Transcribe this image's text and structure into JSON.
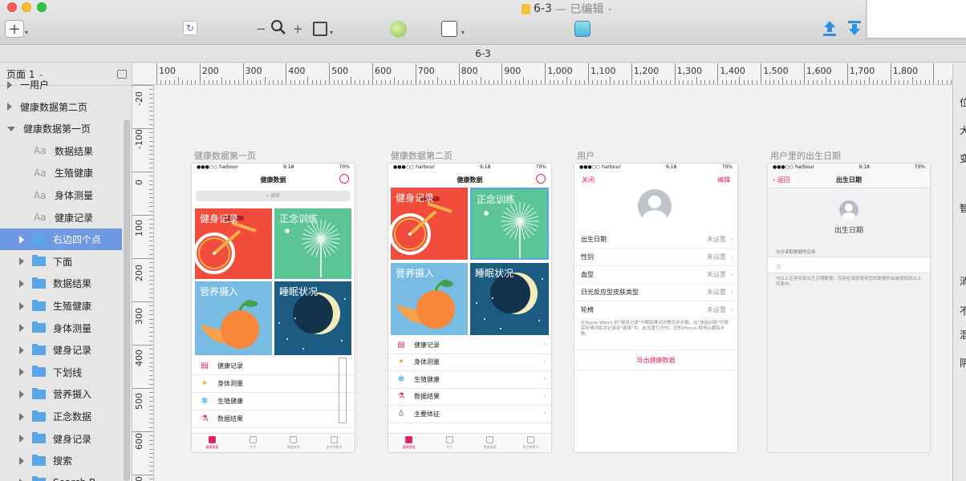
{
  "window": {
    "title": "6-3",
    "subtitle": "— 已编辑",
    "page_name": "6-3"
  },
  "toolbar": {
    "add_label": "+",
    "zoom_out": "−",
    "zoom_in": "+"
  },
  "sidebar": {
    "page_selector": "页面 1",
    "items": [
      {
        "label": "一用户",
        "kind": "group",
        "indent": 0
      },
      {
        "label": "健康数据第二页",
        "kind": "group",
        "indent": 0
      },
      {
        "label": "健康数据第一页",
        "kind": "group-open",
        "indent": 0
      },
      {
        "label": "数据结果",
        "kind": "text",
        "indent": 1
      },
      {
        "label": "生殖健康",
        "kind": "text",
        "indent": 1
      },
      {
        "label": "身体测量",
        "kind": "text",
        "indent": 1
      },
      {
        "label": "健康记录",
        "kind": "text",
        "indent": 1
      },
      {
        "label": "右边四个点",
        "kind": "folder",
        "indent": 1,
        "selected": true
      },
      {
        "label": "下面",
        "kind": "folder",
        "indent": 1
      },
      {
        "label": "数据结果",
        "kind": "folder",
        "indent": 1
      },
      {
        "label": "生殖健康",
        "kind": "folder",
        "indent": 1
      },
      {
        "label": "身体测量",
        "kind": "folder",
        "indent": 1
      },
      {
        "label": "健身记录",
        "kind": "folder",
        "indent": 1
      },
      {
        "label": "下划线",
        "kind": "folder",
        "indent": 1
      },
      {
        "label": "营养摄入",
        "kind": "folder",
        "indent": 1
      },
      {
        "label": "正念数据",
        "kind": "folder",
        "indent": 1
      },
      {
        "label": "健身记录",
        "kind": "folder",
        "indent": 1
      },
      {
        "label": "搜索",
        "kind": "folder",
        "indent": 1
      },
      {
        "label": "Search B...",
        "kind": "folder",
        "indent": 1
      }
    ]
  },
  "rulers": {
    "h_ticks": [
      "100",
      "200",
      "300",
      "400",
      "500",
      "600",
      "700",
      "800",
      "900",
      "1,000",
      "1,100",
      "1,200",
      "1,300",
      "1,400",
      "1,500",
      "1,600",
      "1,700",
      "1,800"
    ],
    "v_ticks": [
      "-20",
      "-100",
      "0",
      "100",
      "200",
      "300",
      "400",
      "500",
      "600",
      "700"
    ]
  },
  "right_panel": {
    "labels": [
      "位",
      "大",
      "变",
      "智",
      "",
      "消",
      "不",
      "混",
      "阴"
    ]
  },
  "artboards": {
    "a1": {
      "label": "健康数据第一页",
      "carrier": "●●●○○ harbour",
      "time": "9:18",
      "battery": "70%",
      "title": "健康数据",
      "search": "搜索",
      "tiles": [
        "健身记录",
        "正念训练",
        "营养摄入",
        "睡眠状况"
      ],
      "rows": [
        "健康记录",
        "身体测量",
        "生殖健康",
        "数据结果"
      ],
      "tabs": [
        "健康数据",
        "今天",
        "数据来源",
        "医疗急救卡"
      ]
    },
    "a2": {
      "label": "健康数据第二页",
      "carrier": "●●●○○ harbour",
      "time": "9:18",
      "battery": "70%",
      "title": "健康数据",
      "tiles": [
        "健身记录",
        "正念训练",
        "营养摄入",
        "睡眠状况"
      ],
      "rows": [
        "健康记录",
        "身体测量",
        "生殖健康",
        "数据结果",
        "主要体征"
      ],
      "tabs": [
        "健康数据",
        "今天",
        "数据来源",
        "医疗急救卡"
      ]
    },
    "a3": {
      "label": "用户",
      "carrier": "●●●○○ harbour",
      "time": "9:18",
      "battery": "70%",
      "close": "关闭",
      "edit": "编辑",
      "rows": [
        {
          "k": "出生日期",
          "v": "未设置"
        },
        {
          "k": "性别",
          "v": "未设置"
        },
        {
          "k": "血型",
          "v": "未设置"
        },
        {
          "k": "日光反应型皮肤类型",
          "v": "未设置"
        },
        {
          "k": "轮椅",
          "v": "未设置"
        }
      ],
      "note": "在Apple Watch 的\"健身记录\"中跟踪推动次数而非步数。在\"体能训练\"中跟踪轮椅训练并记录到\"健康\"中。此设置打开时，您的iPhone 将停止跟踪步数。",
      "export": "导出健康数据"
    },
    "a4": {
      "label": "用户里的出生日期",
      "carrier": "●●●○○ harbour",
      "time": "9:18",
      "battery": "70%",
      "back": "返回",
      "title": "出生日期",
      "heading": "出生日期",
      "section": "允许读取数据的应用",
      "none": "无",
      "note": "与以上应用共享出生日期数据。应用在请求使用您的数据时会被添加到以上列表中。"
    }
  },
  "colors": {
    "red_tile": "#f24c3c",
    "green_tile": "#5cc596",
    "blue_tile": "#78bbe3",
    "night_tile": "#1c5c83",
    "accent": "#e0245e",
    "selection": "#6d9ae3"
  }
}
